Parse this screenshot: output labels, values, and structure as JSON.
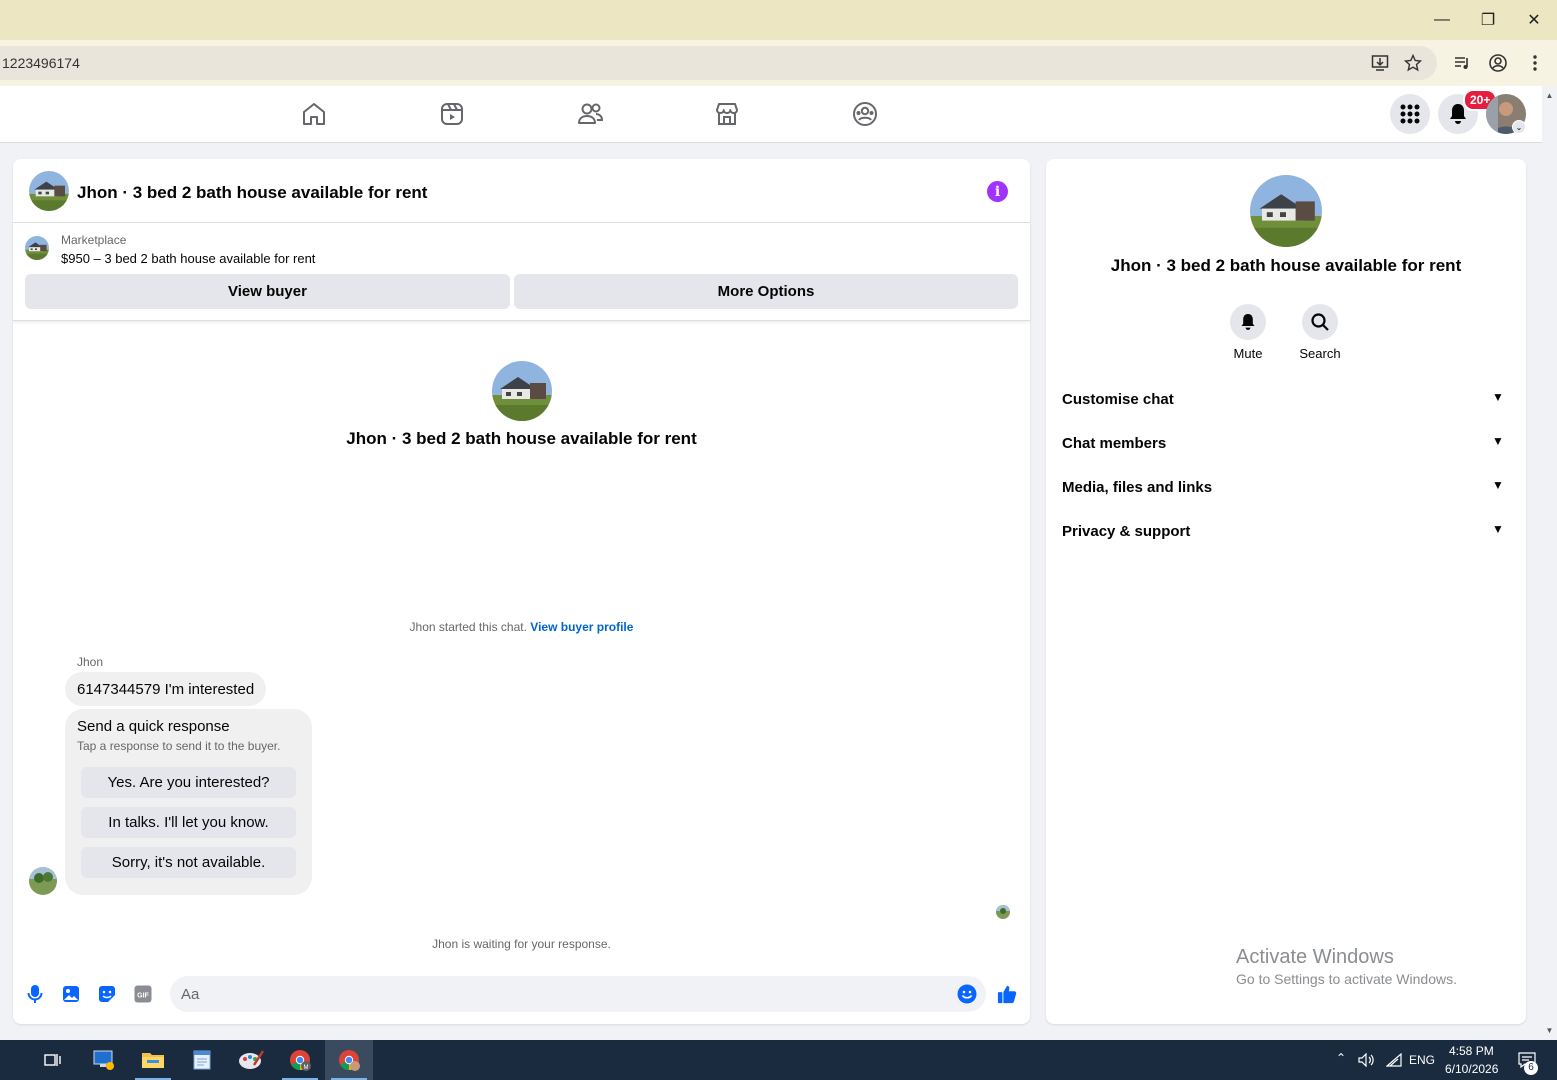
{
  "browser": {
    "url": "1223496174",
    "window_controls": [
      "minimize-icon",
      "restore-icon",
      "close-icon"
    ]
  },
  "nav": {
    "icons": [
      "home-icon",
      "video-icon",
      "friends-icon",
      "marketplace-icon",
      "groups-icon"
    ],
    "notification_badge": "20+"
  },
  "chat": {
    "header_title": "Jhon · 3 bed 2 bath house available for rent",
    "info_glyph": "i",
    "marketplace_label": "Marketplace",
    "listing": "$950 – 3 bed 2 bath house available for rent",
    "view_buyer": "View buyer",
    "more_options": "More Options",
    "center_title": "Jhon · 3 bed 2 bath house available for rent",
    "started_text": "Jhon started this chat.",
    "started_link": "View buyer profile",
    "sender": "Jhon",
    "message": "6147344579 I'm interested",
    "quick": {
      "title": "Send a quick response",
      "subtitle": "Tap a response to send it to the buyer.",
      "responses": [
        "Yes. Are you interested?",
        "In talks. I'll let you know.",
        "Sorry, it's not available."
      ]
    },
    "waiting_text": "Jhon is waiting for your response.",
    "input_placeholder": "Aa",
    "gif_label": "GIF"
  },
  "side": {
    "title": "Jhon · 3 bed 2 bath house available for rent",
    "mute": "Mute",
    "search": "Search",
    "sections": [
      "Customise chat",
      "Chat members",
      "Media, files and links",
      "Privacy & support"
    ]
  },
  "watermark": {
    "line1": "Activate Windows",
    "line2": "Go to Settings to activate Windows."
  },
  "taskbar": {
    "lang": "ENG",
    "time": "4:58 PM",
    "date": "6/10/2026",
    "notif_count": "6"
  },
  "colors": {
    "accent": "#0866ff",
    "info": "#a033ff",
    "badge": "#e41e3f",
    "titlebar": "#ede6c3"
  }
}
